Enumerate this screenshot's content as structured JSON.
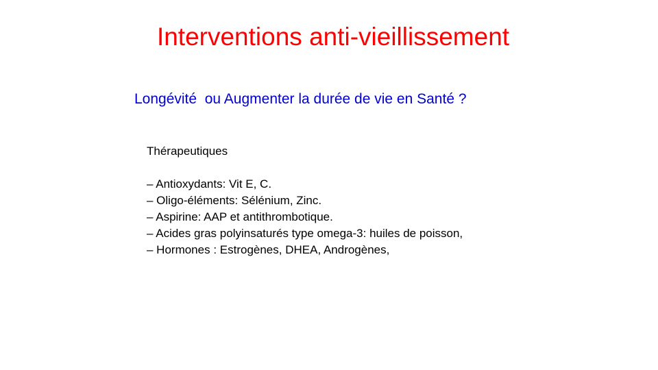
{
  "slide": {
    "title": "Interventions anti-vieillissement",
    "subtitle": "Longévité  ou Augmenter la durée de vie en Santé ?",
    "section_heading": "Thérapeutiques",
    "items": [
      "– Antioxydants: Vit E, C.",
      "– Oligo-éléments: Sélénium,  Zinc.",
      "– Aspirine: AAP et antithrombotique.",
      "– Acides gras polyinsaturés type omega-3: huiles de poisson,",
      "– Hormones : Estrogènes, DHEA, Androgènes,"
    ],
    "colors": {
      "title": "#ff0000",
      "subtitle": "#0000cc",
      "body": "#000000",
      "background": "#ffffff"
    }
  }
}
